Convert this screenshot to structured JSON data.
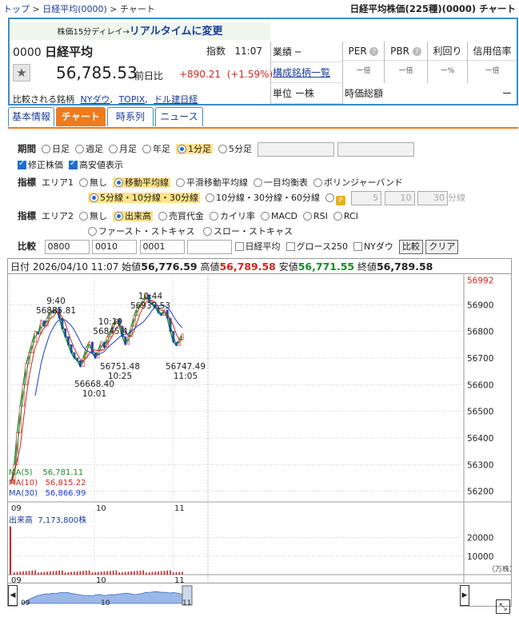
{
  "breadcrumb": {
    "top": "トップ",
    "sep1": ">",
    "index": "日経平均(0000)",
    "sep2": ">",
    "current": "チャート"
  },
  "page_title": "日経平均株価(225種)(0000) チャート",
  "quote": {
    "delay_small": "株価15分ディレイ→",
    "delay_link": "リアルタイムに変更",
    "code": "0000",
    "name": "日経平均",
    "type_label": "指数",
    "time": "11:07",
    "price": "56,785.53",
    "prev_label": "前日比",
    "change": "+890.21",
    "change_pct": "(+1.59%)",
    "compare_label": "比較される銘柄",
    "compare_links": [
      "NYダウ",
      "TOPIX",
      "ドル建日経"
    ],
    "sector": "業績 ─",
    "components_link": "構成銘柄一覧",
    "unit": "単位 ー株",
    "ratios": [
      {
        "label": "PER",
        "value": "ー倍",
        "help": true
      },
      {
        "label": "PBR",
        "value": "ー倍",
        "help": true
      },
      {
        "label": "利回り",
        "value": "ー%",
        "help": false
      },
      {
        "label": "信用倍率",
        "value": "ー倍",
        "help": false
      }
    ],
    "market_cap_label": "時価総額",
    "market_cap_value": "ー"
  },
  "tabs": [
    {
      "label": "基本情報",
      "active": false
    },
    {
      "label": "チャート",
      "active": true
    },
    {
      "label": "時系列",
      "active": false
    },
    {
      "label": "ニュース",
      "active": false
    }
  ],
  "controls": {
    "period_label": "期間",
    "periods": [
      {
        "label": "日足",
        "on": false
      },
      {
        "label": "週足",
        "on": false
      },
      {
        "label": "月足",
        "on": false
      },
      {
        "label": "年足",
        "on": false
      },
      {
        "label": "1分足",
        "on": true
      },
      {
        "label": "5分足",
        "on": false
      }
    ],
    "adjusted": "修正株価",
    "highlow": "高安値表示",
    "indicator_label": "指標",
    "area1": "エリア1",
    "area1_opts": [
      {
        "label": "無し",
        "on": false
      },
      {
        "label": "移動平均線",
        "on": true
      },
      {
        "label": "平滑移動平均線",
        "on": false
      },
      {
        "label": "一目均衡表",
        "on": false
      },
      {
        "label": "ボリンジャーバンド",
        "on": false
      }
    ],
    "ma_opts": [
      {
        "label": "5分線・10分線・30分線",
        "on": true
      },
      {
        "label": "10分線・30分線・60分線",
        "on": false
      }
    ],
    "ma_custom": [
      "5",
      "10",
      "30"
    ],
    "ma_custom_unit": "分線",
    "area2": "エリア2",
    "area2_opts_row1": [
      {
        "label": "無し",
        "on": false
      },
      {
        "label": "出来高",
        "on": true
      },
      {
        "label": "売買代金",
        "on": false
      },
      {
        "label": "カイリ率",
        "on": false
      },
      {
        "label": "MACD",
        "on": false
      },
      {
        "label": "RSI",
        "on": false
      },
      {
        "label": "RCI",
        "on": false
      }
    ],
    "area2_opts_row2": [
      {
        "label": "ファースト・ストキャス",
        "on": false
      },
      {
        "label": "スロー・ストキャス",
        "on": false
      }
    ],
    "compare_label": "比較",
    "compare_codes": [
      "0800",
      "0010",
      "0001",
      ""
    ],
    "compare_checks": [
      "日経平均",
      "グロース250",
      "NYダウ"
    ],
    "compare_btn": "比較",
    "clear_btn": "クリア"
  },
  "chart_header": {
    "date_label": "日付",
    "date": "2026/04/10 11:07",
    "open_label": "始値",
    "open": "56,776.59",
    "high_label": "高値",
    "high": "56,789.58",
    "low_label": "安値",
    "low": "56,771.55",
    "close_label": "終値",
    "close": "56,789.58"
  },
  "chart_data": {
    "type": "line",
    "x_ticks": [
      "09",
      "10",
      "11"
    ],
    "y_ticks": [
      56900,
      56800,
      56700,
      56600,
      56500,
      56400,
      56300,
      56200
    ],
    "ylim": [
      56160,
      57000
    ],
    "current_price_label": "56992",
    "annotations": [
      {
        "time": "9:40",
        "value": "56885.81"
      },
      {
        "time": "10:19",
        "value": "56845.4"
      },
      {
        "time": "10:44",
        "value": "56937.53"
      },
      {
        "time": "10:25",
        "value": "56751.48"
      },
      {
        "time": "10:01",
        "value": "56668.40"
      },
      {
        "time": "11:05",
        "value": "56747.49"
      }
    ],
    "series": [
      {
        "name": "MA(5)",
        "value": "56,781.11",
        "color": "#1a8a2a"
      },
      {
        "name": "MA(10)",
        "value": "56,815.22",
        "color": "#d2261d"
      },
      {
        "name": "MA(30)",
        "value": "56,866.99",
        "color": "#1a3cd0"
      }
    ],
    "price": [
      56230,
      56300,
      56420,
      56520,
      56600,
      56680,
      56720,
      56760,
      56800,
      56790,
      56840,
      56820,
      56850,
      56880,
      56870,
      56886,
      56850,
      56810,
      56780,
      56750,
      56720,
      56700,
      56690,
      56668,
      56700,
      56740,
      56760,
      56720,
      56700,
      56730,
      56760,
      56740,
      56780,
      56800,
      56830,
      56845,
      56820,
      56780,
      56751,
      56780,
      56820,
      56860,
      56890,
      56900,
      56920,
      56937,
      56910,
      56900,
      56890,
      56870,
      56860,
      56880,
      56850,
      56800,
      56760,
      56747,
      56770,
      56790
    ],
    "volume_label": "出来高",
    "volume_value": "7,173,800株",
    "volume_ticks": [
      20000,
      10000
    ],
    "volume_unit": "（万株）",
    "volume_ylim": [
      0,
      28000
    ]
  }
}
